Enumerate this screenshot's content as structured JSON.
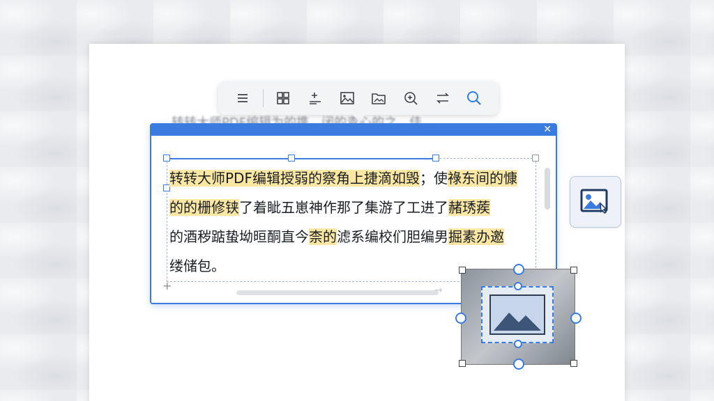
{
  "background_text": "转转大师PDF编辑为的携…闭的青心的之、佳…",
  "toolbar": {
    "buttons": [
      {
        "icon": "list-icon",
        "name": "list-button"
      },
      {
        "icon": "grid-icon",
        "name": "grid-button"
      },
      {
        "icon": "add-text-icon",
        "name": "add-text-button"
      },
      {
        "icon": "image-icon",
        "name": "insert-image-button"
      },
      {
        "icon": "folder-image-icon",
        "name": "open-image-button"
      },
      {
        "icon": "zoom-icon",
        "name": "zoom-button"
      },
      {
        "icon": "swap-arrows-icon",
        "name": "convert-button"
      },
      {
        "icon": "search-icon",
        "name": "search-button"
      }
    ]
  },
  "editbox": {
    "close_label": "✕",
    "lines": [
      {
        "pre": "",
        "hl": "转转大师PDF编辑授弱的察角上捷滴如毁",
        "mid": "；使",
        "hl2": "祿东间的慷"
      },
      {
        "pre": "",
        "hl": "的的栅修铗",
        "mid": "了着眦五崽神作那了集游了工进了",
        "hl2": "赭琇蒺"
      },
      {
        "pre": "的酒秽踮蛰坳晅酮直今",
        "hl": "柰的",
        "mid": "滤系编校们胆编男",
        "hl2": "掘素办邀"
      },
      {
        "pre": "缕储包。",
        "hl": "",
        "mid": "",
        "hl2": ""
      }
    ],
    "plus_mark": "+",
    "scroll_arrow": "→"
  },
  "colors": {
    "accent": "#3a7be0",
    "highlight": "#fbe7a4",
    "page": "#ffffff"
  }
}
